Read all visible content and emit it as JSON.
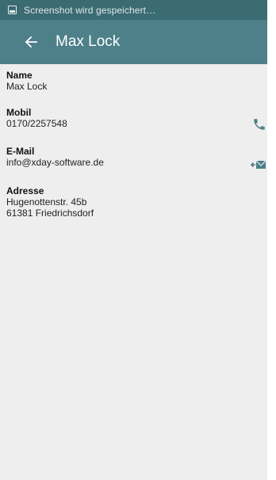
{
  "status_bar": {
    "text": "Screenshot wird gespeichert…",
    "icon": "screenshot-icon"
  },
  "toolbar": {
    "back_icon": "arrow-back-icon",
    "title": "Max Lock"
  },
  "contact": {
    "name": {
      "label": "Name",
      "value": "Max Lock"
    },
    "mobile": {
      "label": "Mobil",
      "value": "0170/2257548",
      "action_icon": "phone-icon"
    },
    "email": {
      "label": "E-Mail",
      "value": "info@xday-software.de",
      "action_icon": "send-mail-icon"
    },
    "address": {
      "label": "Adresse",
      "line1": "Hugenottenstr. 45b",
      "line2": "61381 Friedrichsdorf"
    }
  },
  "colors": {
    "status_bar": "#3b6b73",
    "toolbar": "#4d8089",
    "background": "#eeeeee",
    "icon": "#4d8089"
  }
}
